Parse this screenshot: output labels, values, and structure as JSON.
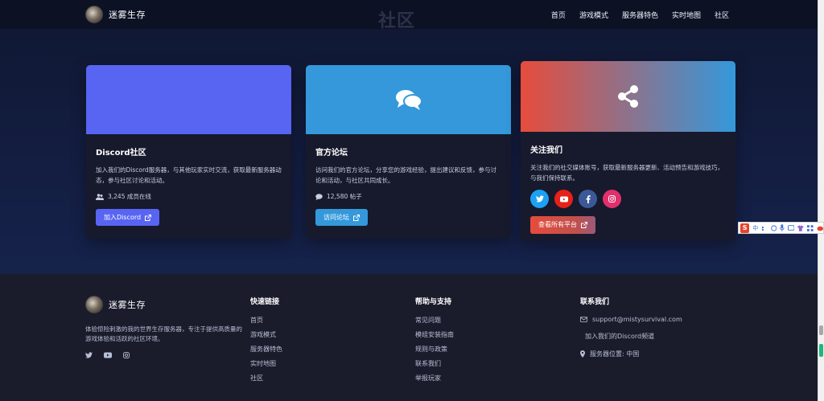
{
  "nav": {
    "brand": "迷雾生存",
    "links": [
      "首页",
      "游戏模式",
      "服务器特色",
      "实时地图",
      "社区"
    ],
    "ghost_title": "社区"
  },
  "cards": [
    {
      "title": "Discord社区",
      "desc": "加入我们的Discord服务器，与其他玩家实时交流，获取最新服务器动态，参与社区讨论和活动。",
      "stat": "3,245 成员在线",
      "button": "加入Discord",
      "color": "#5865f2"
    },
    {
      "title": "官方论坛",
      "desc": "访问我们的官方论坛，分享您的游戏经验，提出建议和反馈，参与讨论和活动，与社区共同成长。",
      "stat": "12,580 帖子",
      "button": "访问论坛",
      "color": "#3498db"
    },
    {
      "title": "关注我们",
      "desc": "关注我们的社交媒体账号，获取最新服务器更新、活动预告和游戏技巧，与我们保持联系。",
      "button": "查看所有平台",
      "gradient": [
        "#e74c3c",
        "#3498db"
      ],
      "socials": [
        "twitter-icon",
        "youtube-icon",
        "facebook-icon",
        "instagram-icon"
      ]
    }
  ],
  "footer": {
    "brand": "迷雾生存",
    "desc": "体验惊险刺激的我的世界生存服务器，专注于提供高质量的游戏体验和活跃的社区环境。",
    "quick_title": "快速链接",
    "quick_links": [
      "首页",
      "游戏模式",
      "服务器特色",
      "实时地图",
      "社区"
    ],
    "help_title": "帮助与支持",
    "help_links": [
      "常见问题",
      "模组安装指南",
      "规则与政策",
      "联系我们",
      "举报玩家"
    ],
    "contact_title": "联系我们",
    "email": "support@mistysurvival.com",
    "discord": "加入我们的Discord频道",
    "location": "服务器位置: 中国"
  },
  "ime": {
    "logo": "S",
    "mode": "中"
  }
}
